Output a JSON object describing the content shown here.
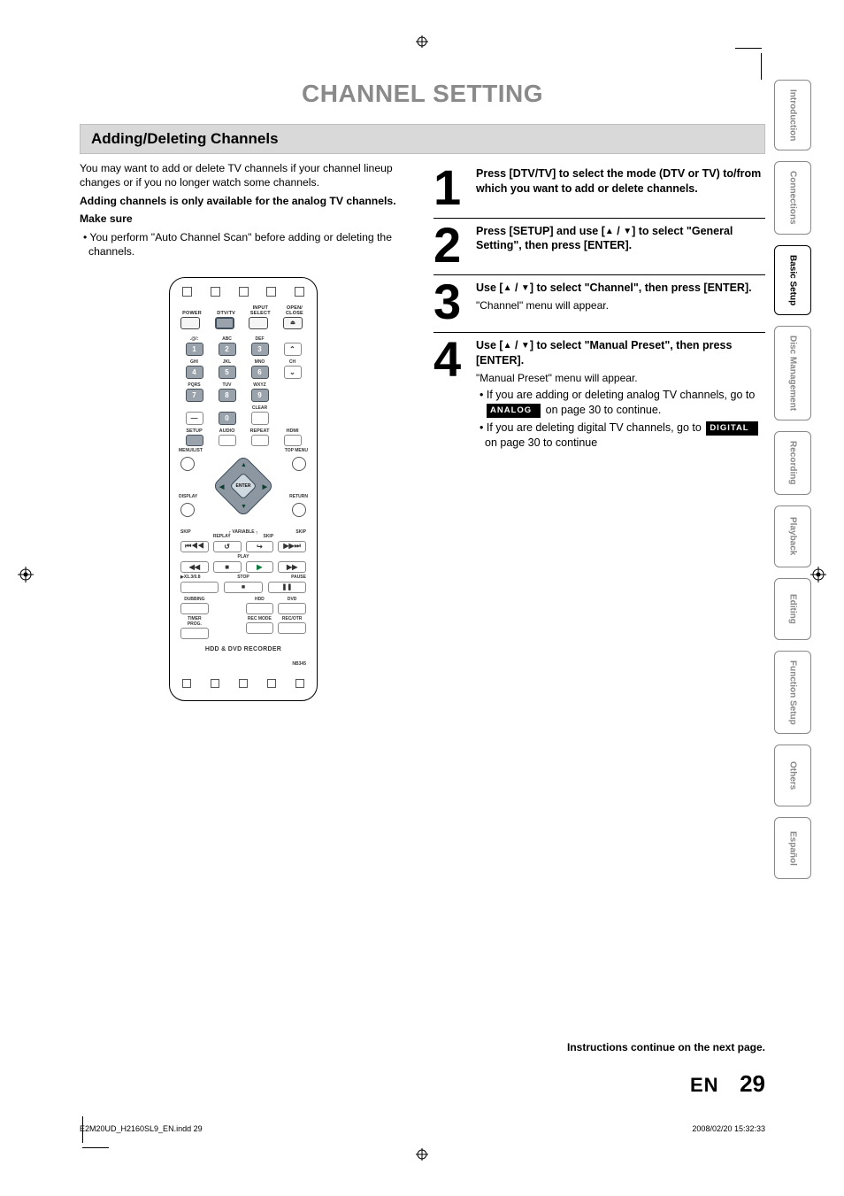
{
  "title": "CHANNEL SETTING",
  "section_header": "Adding/Deleting Channels",
  "intro": {
    "p1": "You may want to add or delete TV channels if your channel lineup changes or if you no longer watch some channels.",
    "p2": "Adding channels is only available for the analog TV channels.",
    "p3": "Make sure",
    "p4": "• You perform \"Auto Channel Scan\" before adding or deleting the channels."
  },
  "steps": [
    {
      "num": "1",
      "strong": "Press [DTV/TV] to select the mode (DTV or TV) to/from which you want to add or delete channels."
    },
    {
      "num": "2",
      "strong_a": "Press [SETUP] and use [",
      "strong_b": "] to select \"General Setting\", then press [ENTER]."
    },
    {
      "num": "3",
      "strong_a": "Use [",
      "strong_b": "] to select \"Channel\", then press [ENTER].",
      "sub": "\"Channel\" menu will appear."
    },
    {
      "num": "4",
      "strong_a": "Use [",
      "strong_b": "] to select \"Manual Preset\", then press [ENTER].",
      "sub": "\"Manual Preset\" menu will appear.",
      "li1a": "• If you are adding or deleting analog TV channels, go to ",
      "li1b": " on page 30 to continue.",
      "li2a": "• If you are deleting digital TV channels, go to ",
      "li2b": " on page 30 to continue"
    }
  ],
  "badge_analog": "ANALOG",
  "badge_digital": "DIGITAL",
  "continue_note": "Instructions continue on the next page.",
  "page_lang": "EN",
  "page_num": "29",
  "tabs": [
    "Introduction",
    "Connections",
    "Basic Setup",
    "Disc Management",
    "Recording",
    "Playback",
    "Editing",
    "Function Setup",
    "Others",
    "Español"
  ],
  "remote": {
    "row1": {
      "power": "POWER",
      "dtvtv": "DTV/TV",
      "input": "INPUT SELECT",
      "open": "OPEN/ CLOSE",
      "eject": "⏏"
    },
    "keys": {
      "r1": [
        ".@/:",
        "ABC",
        "DEF"
      ],
      "r2": [
        "GHI",
        "JKL",
        "MNO"
      ],
      "r3": [
        "PQRS",
        "TUV",
        "WXYZ"
      ],
      "nums": [
        "1",
        "2",
        "3",
        "4",
        "5",
        "6",
        "7",
        "8",
        "9",
        "0"
      ],
      "ch": "CH",
      "clear": "CLEAR"
    },
    "row3": {
      "setup": "SETUP",
      "audio": "AUDIO",
      "repeat": "REPEAT",
      "hdmi": "HDMI"
    },
    "nav": {
      "menu": "MENU/LIST",
      "top": "TOP MENU",
      "display": "DISPLAY",
      "ret": "RETURN",
      "enter": "ENTER"
    },
    "var": {
      "variable": "VARIABLE",
      "skip": "SKIP",
      "replay": "REPLAY",
      "skip2": "SKIP"
    },
    "wide": [
      "⏮◀◀",
      "↺",
      "↪",
      "▶▶⏭"
    ],
    "play_label": "PLAY",
    "play": [
      "◀◀",
      "■",
      "▶",
      "▶▶"
    ],
    "row6": {
      "x13": "▶X1.3/0.8",
      "stop": "STOP",
      "pause": "PAUSE",
      "pause_icon": "❚❚",
      "stop_icon": "■"
    },
    "row7": {
      "dub": "DUBBING",
      "hdd": "HDD",
      "dvd": "DVD"
    },
    "row8": {
      "timer": "TIMER PROG.",
      "recmode": "REC MODE",
      "recotr": "REC/OTR"
    },
    "brand": "HDD & DVD RECORDER",
    "model": "NB345"
  },
  "footer": {
    "left": "E2M20UD_H2160SL9_EN.indd   29",
    "right": "2008/02/20   15:32:33"
  }
}
